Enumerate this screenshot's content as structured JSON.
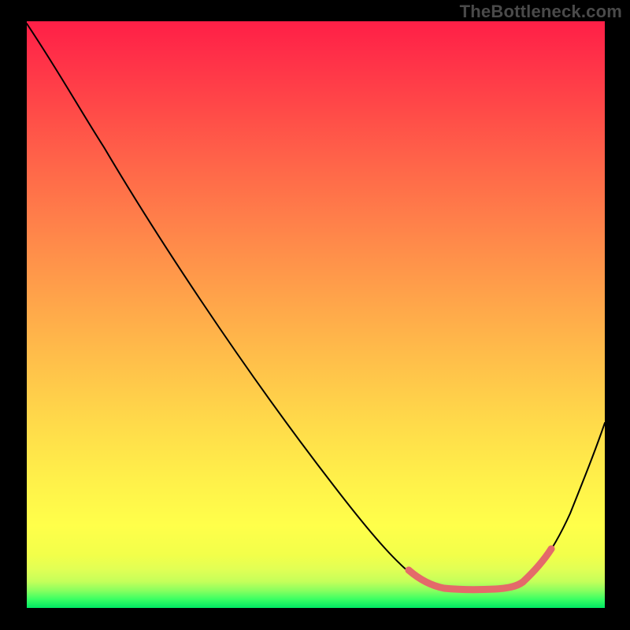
{
  "watermark": "TheBottleneck.com",
  "chart_data": {
    "type": "line",
    "title": "",
    "xlabel": "",
    "ylabel": "",
    "xlim": [
      0,
      100
    ],
    "ylim": [
      0,
      100
    ],
    "grid": false,
    "series": [
      {
        "name": "bottleneck-curve",
        "color": "#000000",
        "x": [
          0,
          5,
          10,
          15,
          20,
          25,
          30,
          35,
          40,
          45,
          50,
          55,
          60,
          65,
          68,
          72,
          76,
          80,
          84,
          87,
          90,
          93,
          96,
          100
        ],
        "y": [
          100,
          94,
          87,
          80,
          72,
          64,
          56,
          48,
          40,
          33,
          26,
          20,
          14,
          10,
          7,
          5,
          4,
          3,
          3,
          4,
          6,
          12,
          22,
          32
        ]
      },
      {
        "name": "optimal-range-highlight",
        "color": "#e46a6a",
        "x": [
          66,
          69,
          72,
          75,
          78,
          81,
          84,
          87,
          90
        ],
        "y": [
          7,
          5,
          4,
          3,
          3,
          3,
          3,
          4,
          6
        ]
      }
    ],
    "background_gradient": {
      "direction": "vertical",
      "stops": [
        {
          "pos": 0.0,
          "color": "#ff1f47"
        },
        {
          "pos": 0.25,
          "color": "#ff6749"
        },
        {
          "pos": 0.55,
          "color": "#ffb84a"
        },
        {
          "pos": 0.86,
          "color": "#ffff4a"
        },
        {
          "pos": 0.97,
          "color": "#8aff5f"
        },
        {
          "pos": 1.0,
          "color": "#00e863"
        }
      ]
    },
    "annotations": [
      {
        "text": "TheBottleneck.com",
        "role": "watermark",
        "position": "top-right",
        "color": "#4a4a4a"
      }
    ]
  }
}
